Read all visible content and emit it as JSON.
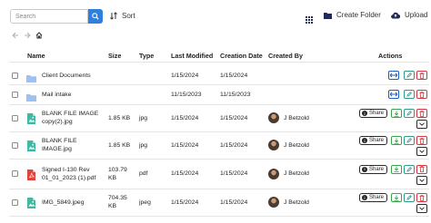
{
  "toolbar": {
    "search_placeholder": "Search",
    "sort_label": "Sort",
    "create_folder_label": "Create Folder",
    "upload_label": "Upload"
  },
  "table": {
    "headers": {
      "name": "Name",
      "size": "Size",
      "type": "Type",
      "last_modified": "Last Modified",
      "creation_date": "Creation Date",
      "created_by": "Created By",
      "actions": "Actions"
    },
    "rows": [
      {
        "kind": "folder",
        "name_lines": [
          "Client Documents"
        ],
        "size_lines": [],
        "type": "",
        "last_modified": "1/15/2024",
        "creation_date": "1/15/2024",
        "created_by": ""
      },
      {
        "kind": "folder",
        "name_lines": [
          "Mail intake"
        ],
        "size_lines": [],
        "type": "",
        "last_modified": "11/15/2023",
        "creation_date": "11/15/2023",
        "created_by": ""
      },
      {
        "kind": "image",
        "name_lines": [
          "BLANK FILE IMAGE",
          "copy(2).jpg"
        ],
        "size_lines": [
          "1.85 KB"
        ],
        "type": "jpg",
        "last_modified": "1/15/2024",
        "creation_date": "1/15/2024",
        "created_by": "J Betzold",
        "share": "Share"
      },
      {
        "kind": "image",
        "name_lines": [
          "BLANK FILE",
          "IMAGE.jpg"
        ],
        "size_lines": [
          "1.85 KB"
        ],
        "type": "jpg",
        "last_modified": "1/15/2024",
        "creation_date": "1/15/2024",
        "created_by": "J Betzold",
        "share": "Share"
      },
      {
        "kind": "pdf",
        "name_lines": [
          "Signed I-130 Rev",
          "01_01_2023 (1).pdf"
        ],
        "size_lines": [
          "103.79",
          "KB"
        ],
        "type": "pdf",
        "last_modified": "1/15/2024",
        "creation_date": "1/15/2024",
        "created_by": "J Betzold",
        "share": "Share"
      },
      {
        "kind": "image",
        "name_lines": [
          "IMG_5849.jpeg"
        ],
        "size_lines": [
          "704.35",
          "KB"
        ],
        "type": "jpeg",
        "last_modified": "1/15/2024",
        "creation_date": "1/15/2024",
        "created_by": "J Betzold",
        "share": "Share"
      }
    ]
  },
  "colors": {
    "accent": "#2f7fe0",
    "folder": "#9cc2f2",
    "image_file": "#3fb9a4",
    "pdf_file": "#e0443a",
    "move_border": "#1e5fbf",
    "download_border": "#3aa64a",
    "edit_border": "#2d9a8a",
    "delete_border": "#d9363e"
  }
}
